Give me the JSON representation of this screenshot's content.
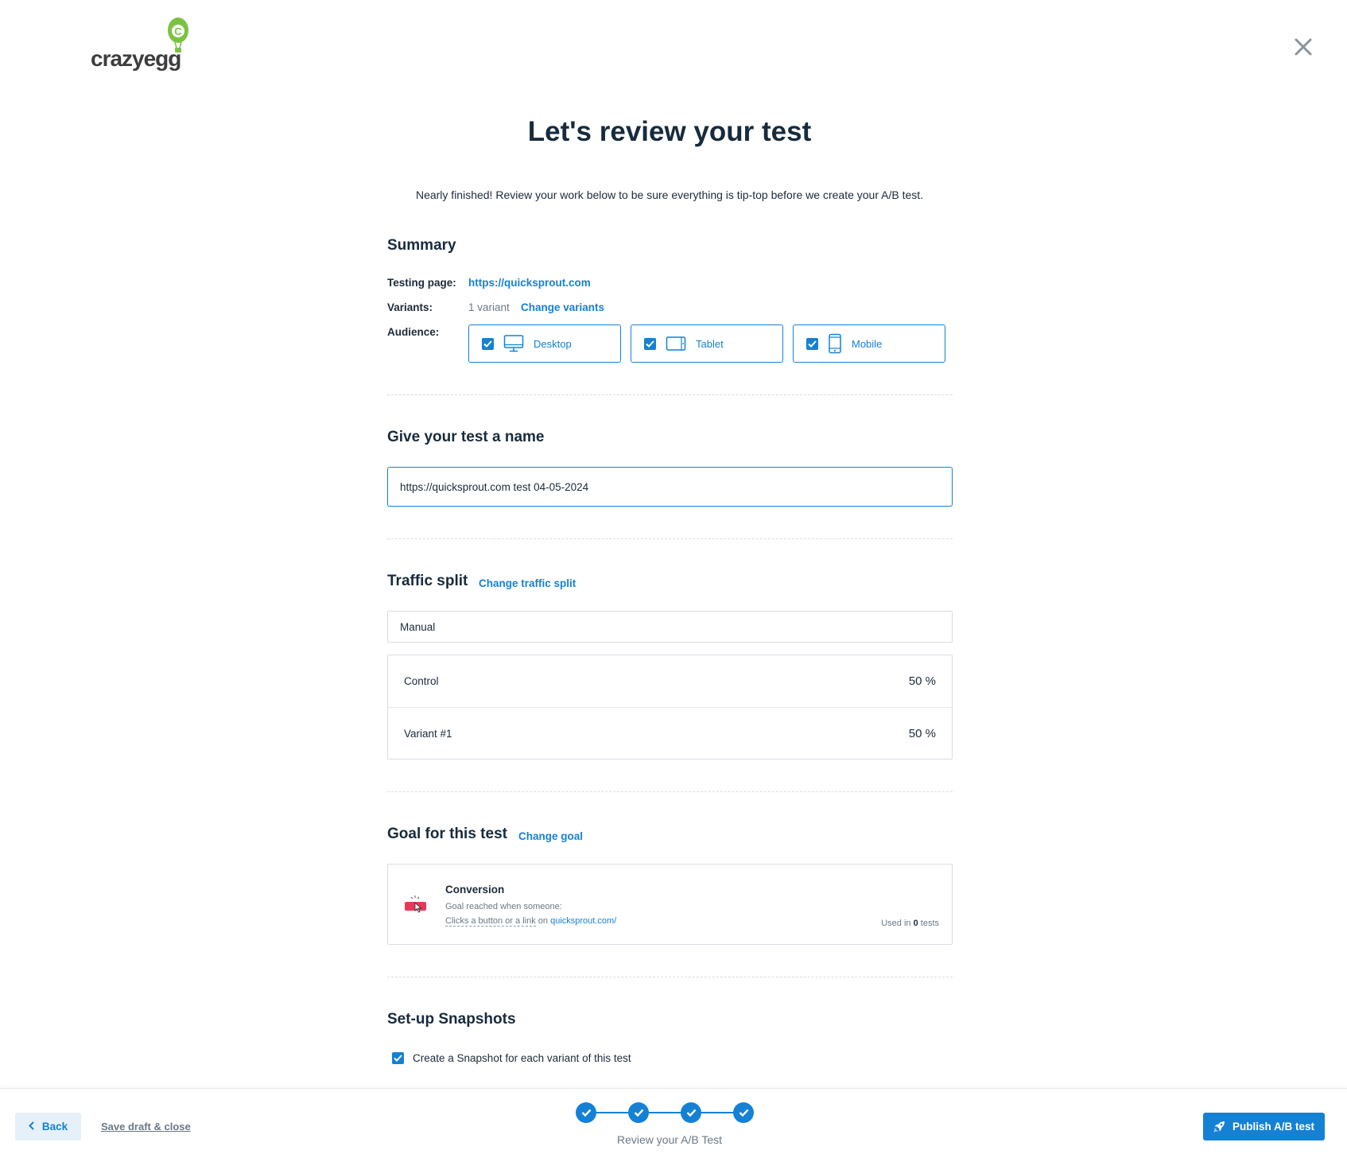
{
  "brand": {
    "name": "crazyegg",
    "accent": "#1581d4",
    "logo_green": "#7cc242"
  },
  "header": {
    "title": "Let's review your test",
    "subtitle": "Nearly finished! Review your work below to be sure everything is tip-top before we create your A/B test."
  },
  "summary": {
    "heading": "Summary",
    "testing_page_label": "Testing page:",
    "testing_page_value": "https://quicksprout.com",
    "variants_label": "Variants:",
    "variants_value": "1 variant",
    "change_variants": "Change variants",
    "audience_label": "Audience:",
    "audience": [
      {
        "label": "Desktop",
        "checked": true,
        "icon": "desktop-icon"
      },
      {
        "label": "Tablet",
        "checked": true,
        "icon": "tablet-icon"
      },
      {
        "label": "Mobile",
        "checked": true,
        "icon": "mobile-icon"
      }
    ]
  },
  "name_section": {
    "heading": "Give your test a name",
    "value": "https://quicksprout.com test 04-05-2024"
  },
  "traffic": {
    "heading": "Traffic split",
    "change_link": "Change traffic split",
    "mode": "Manual",
    "rows": [
      {
        "label": "Control",
        "value": "50 %"
      },
      {
        "label": "Variant #1",
        "value": "50 %"
      }
    ]
  },
  "goal": {
    "heading": "Goal for this test",
    "change_link": "Change goal",
    "title": "Conversion",
    "line1": "Goal reached when someone:",
    "action": "Clicks a button or a link",
    "on": "on",
    "url": "quicksprout.com/",
    "used_prefix": "Used in",
    "used_count": "0",
    "used_suffix": "tests"
  },
  "snapshots": {
    "heading": "Set-up Snapshots",
    "checkbox_label": "Create a Snapshot for each variant of this test",
    "checked": true
  },
  "footer": {
    "back": "Back",
    "save": "Save draft & close",
    "steps_completed": 4,
    "step_caption": "Review your A/B Test",
    "publish": "Publish A/B test"
  }
}
